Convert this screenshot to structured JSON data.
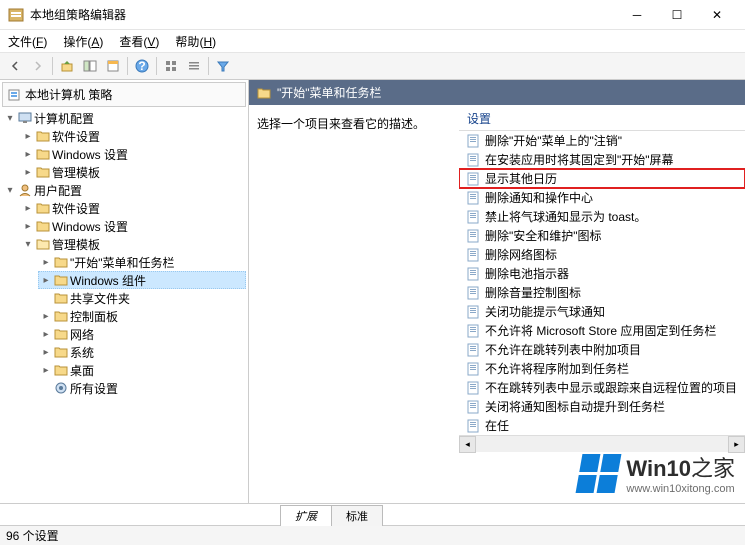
{
  "window": {
    "title": "本地组策略编辑器"
  },
  "menu": {
    "file": {
      "label": "文件",
      "key": "F"
    },
    "action": {
      "label": "操作",
      "key": "A"
    },
    "view": {
      "label": "查看",
      "key": "V"
    },
    "help": {
      "label": "帮助",
      "key": "H"
    }
  },
  "tree": {
    "root": "本地计算机 策略",
    "computer": {
      "label": "计算机配置",
      "children": {
        "software": "软件设置",
        "windows": "Windows 设置",
        "admin": "管理模板"
      }
    },
    "user": {
      "label": "用户配置",
      "children": {
        "software": "软件设置",
        "windows": "Windows 设置",
        "admin": {
          "label": "管理模板",
          "children": {
            "start": "\"开始\"菜单和任务栏",
            "components": "Windows 组件",
            "shared": "共享文件夹",
            "control": "控制面板",
            "network": "网络",
            "system": "系统",
            "desktop": "桌面",
            "all": "所有设置"
          }
        }
      }
    }
  },
  "content": {
    "header": "\"开始\"菜单和任务栏",
    "desc_prompt": "选择一个项目来查看它的描述。",
    "settings_header": "设置",
    "items": [
      "删除\"开始\"菜单上的\"注销\"",
      "在安装应用时将其固定到\"开始\"屏幕",
      "显示其他日历",
      "删除通知和操作中心",
      "禁止将气球通知显示为 toast。",
      "删除\"安全和维护\"图标",
      "删除网络图标",
      "删除电池指示器",
      "删除音量控制图标",
      "关闭功能提示气球通知",
      "不允许将 Microsoft Store 应用固定到任务栏",
      "不允许在跳转列表中附加项目",
      "不允许将程序附加到任务栏",
      "不在跳转列表中显示或跟踪来自远程位置的项目",
      "关闭将通知图标自动提升到任务栏",
      "在任"
    ],
    "highlighted_index": 2
  },
  "tabs": {
    "extended": "扩展",
    "standard": "标准"
  },
  "status": {
    "text": "96 个设置"
  },
  "watermark": {
    "brand": "Win10",
    "suffix": "之家",
    "url": "www.win10xitong.com"
  }
}
